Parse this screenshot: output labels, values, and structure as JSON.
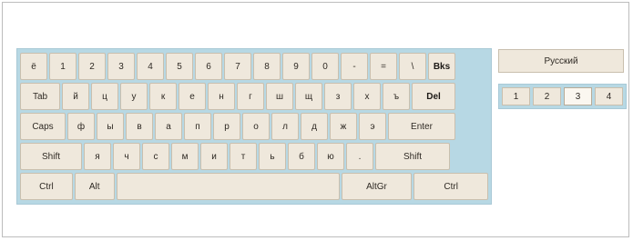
{
  "keyboard": {
    "rows": [
      [
        "ё",
        "1",
        "2",
        "3",
        "4",
        "5",
        "6",
        "7",
        "8",
        "9",
        "0",
        "-",
        "=",
        "\\",
        "Bks"
      ],
      [
        "Tab",
        "й",
        "ц",
        "у",
        "к",
        "е",
        "н",
        "г",
        "ш",
        "щ",
        "з",
        "х",
        "ъ",
        "Del"
      ],
      [
        "Caps",
        "ф",
        "ы",
        "в",
        "а",
        "п",
        "р",
        "о",
        "л",
        "д",
        "ж",
        "э",
        "Enter"
      ],
      [
        "Shift",
        "я",
        "ч",
        "с",
        "м",
        "и",
        "т",
        "ь",
        "б",
        "ю",
        ".",
        "Shift"
      ],
      [
        "Ctrl",
        "Alt",
        " ",
        "AltGr",
        "Ctrl"
      ]
    ]
  },
  "panel": {
    "language": "Русский",
    "pages": [
      "1",
      "2",
      "3",
      "4"
    ],
    "active_page": "3"
  },
  "colors": {
    "key_bg": "#efe8dc",
    "keyboard_bg": "#b7d8e4",
    "key_border": "#c9bfae"
  }
}
